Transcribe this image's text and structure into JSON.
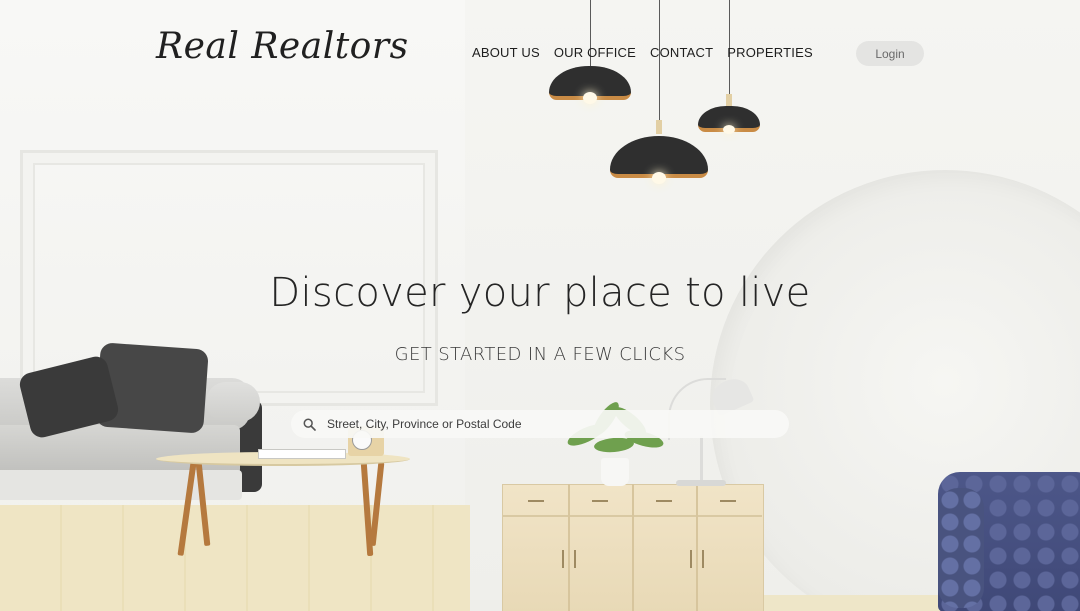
{
  "brand": {
    "logo_text": "Real Realtors"
  },
  "nav": {
    "items": [
      {
        "label": "ABOUT US"
      },
      {
        "label": "OUR OFFICE"
      },
      {
        "label": "CONTACT"
      },
      {
        "label": "PROPERTIES"
      }
    ],
    "login_label": "Login"
  },
  "hero": {
    "title": "Discover your place to live",
    "subtitle": "GET STARTED IN A FEW CLICKS"
  },
  "search": {
    "placeholder": "Street, City, Province or Postal Code",
    "value": "",
    "icon": "search-icon"
  },
  "colors": {
    "text_primary": "#252525",
    "button_bg": "#e4e4e2",
    "chair_blue": "#4d5789"
  }
}
